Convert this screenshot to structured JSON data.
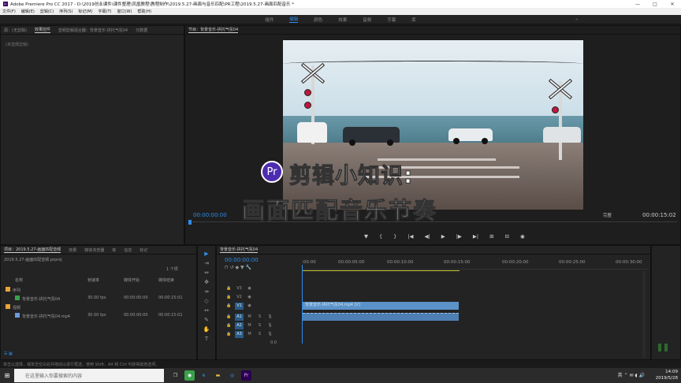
{
  "window": {
    "title": "Adobe Premiere Pro CC 2017 - D:\\2019创业课件\\课件整理\\凤凰教程\\教程制作\\2019.5.27-画面与音乐匹配\\PR工程\\2019.5.27-画面匹配音乐 *",
    "app_icon": "Pr",
    "minimize": "—",
    "maximize": "□",
    "close": "✕"
  },
  "menu": [
    "文件(F)",
    "编辑(E)",
    "剪辑(C)",
    "序列(S)",
    "标记(M)",
    "字幕(T)",
    "窗口(W)",
    "帮助(H)"
  ],
  "workspaces": {
    "items": [
      "组件",
      "编辑",
      "颜色",
      "效果",
      "音频",
      "字幕",
      "库"
    ],
    "active": "编辑",
    "more": "»"
  },
  "effects_panel": {
    "tabs": [
      "源：(无剪辑)",
      "效果控件",
      "音频剪辑混合器：背景音乐-拱托气氛04",
      "元数据"
    ],
    "active_tab": "效果控件",
    "no_clip": "(未选择剪辑)"
  },
  "program_monitor": {
    "tab": "节目：背景音乐-拱托气氛04",
    "timecode_left": "00:00:00:00",
    "fit": "完整",
    "timecode_right": "00:00:15:02",
    "transport": [
      "▼",
      "{",
      "}",
      "|◀",
      "◀|",
      "▶",
      "|▶",
      "▶|",
      "⊞",
      "⊟",
      "◉"
    ],
    "overlay_badge": "Pr",
    "overlay_title": "剪辑小知识:",
    "overlay_subtitle": "画面匹配音乐节奏"
  },
  "project_panel": {
    "tabs": [
      "项目：2019.5.27-画面匹配音频",
      "效果",
      "媒体浏览器",
      "库",
      "信息",
      "标记"
    ],
    "active_tab": "项目：2019.5.27-画面匹配音频",
    "file": "2019.5.27-画面匹配音频.prproj",
    "count": "1 个项",
    "columns": [
      "名称",
      "帧速率",
      "媒体开始",
      "媒体结束"
    ],
    "rows": [
      {
        "indent": 0,
        "type": "folder",
        "color": "#e8a33a",
        "name": "序列",
        "fps": "",
        "start": "",
        "end": ""
      },
      {
        "indent": 1,
        "type": "sequence",
        "color": "#3aa14a",
        "name": "背景音乐-拱托气氛04",
        "fps": "30.00 fps",
        "start": "00:00:00:00",
        "end": "00:00:15:01"
      },
      {
        "indent": 0,
        "type": "folder",
        "color": "#e8a33a",
        "name": "视频",
        "fps": "",
        "start": "",
        "end": ""
      },
      {
        "indent": 1,
        "type": "clip",
        "color": "#6d9ae0",
        "name": "背景音乐-拱托气氛04.mp4",
        "fps": "30.00 fps",
        "start": "00:00:00:00",
        "end": "00:00:15:01"
      }
    ]
  },
  "tools": [
    "▶",
    "⇥",
    "⇔",
    "✥",
    "⇸",
    "◇",
    "↔",
    "✎",
    "✋",
    "T"
  ],
  "timeline": {
    "tab": "背景音乐-拱托气氛04",
    "timecode": "00:00:00:00",
    "ruler": [
      ":00:00",
      "00:00:05:00",
      "00:00:10:00",
      "00:00:15:00",
      "00:00:20:00",
      "00:00:25:00",
      "00:00:30:00"
    ],
    "video_tracks": [
      "V3",
      "V2",
      "V1"
    ],
    "audio_tracks": [
      "A1",
      "A2",
      "A3"
    ],
    "master": "0.0",
    "video_clip": "背景音乐-拱托气氛04.mp4 [V]"
  },
  "status": "单击以选择，或单击空白处并拖动以进行框选，使用 Shift、Alt 和 Ctrl 可获得其他选项。",
  "taskbar": {
    "search_placeholder": "在这里输入你要搜索的内容",
    "tray": "英 ⌃ ✉ ◖ 🔊",
    "time": "14:09",
    "date": "2019/5/28"
  },
  "colors": {
    "accent": "#2d8ceb",
    "video_clip": "#5b93c9",
    "audio_clip": "#4e7fb4",
    "playhead": "#2d8ceb"
  }
}
